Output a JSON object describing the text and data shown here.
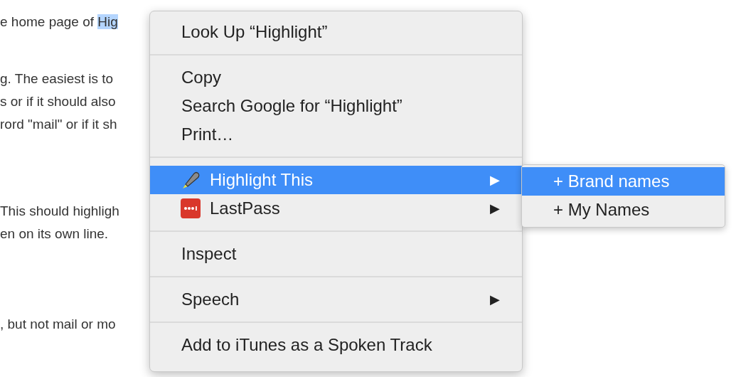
{
  "document": {
    "lines": [
      {
        "segments": [
          {
            "text": "e home page of ",
            "selected": false
          },
          {
            "text": "Hig",
            "selected": true
          }
        ]
      },
      {
        "segments": [
          {
            "text": "g. The easiest is to",
            "selected": false
          }
        ]
      },
      {
        "segments": [
          {
            "text": "s or if it should also",
            "selected": false
          }
        ]
      },
      {
        "segments": [
          {
            "text": "rord \"mail\" or if it sh",
            "selected": false
          }
        ]
      },
      {
        "segments": [
          {
            "text": "This should highligh",
            "selected": false
          }
        ]
      },
      {
        "segments": [
          {
            "text": "en on its own line.",
            "selected": false
          }
        ]
      },
      {
        "segments": [
          {
            "text": ", but not mail or mo",
            "selected": false
          }
        ]
      }
    ]
  },
  "context_menu": {
    "items": [
      {
        "kind": "item",
        "label": "Look Up “Highlight”",
        "selected": false
      },
      {
        "kind": "separator"
      },
      {
        "kind": "item",
        "label": "Copy",
        "selected": false
      },
      {
        "kind": "item",
        "label": "Search Google for “Highlight”",
        "selected": false
      },
      {
        "kind": "item",
        "label": "Print…",
        "selected": false
      },
      {
        "kind": "separator"
      },
      {
        "kind": "marker_item",
        "label": "Highlight This",
        "selected": true,
        "arrow": "▶"
      },
      {
        "kind": "dots_item",
        "label": "LastPass",
        "selected": false,
        "arrow": "▶"
      },
      {
        "kind": "separator"
      },
      {
        "kind": "item",
        "label": "Inspect",
        "selected": false
      },
      {
        "kind": "separator"
      },
      {
        "kind": "item",
        "label": "Speech",
        "selected": false,
        "arrow": "▶"
      },
      {
        "kind": "separator"
      },
      {
        "kind": "item",
        "label": "Add to iTunes as a Spoken Track",
        "selected": false
      }
    ]
  },
  "submenu": {
    "items": [
      {
        "label": "+ Brand names",
        "selected": true
      },
      {
        "label": "+ My Names",
        "selected": false
      }
    ]
  }
}
